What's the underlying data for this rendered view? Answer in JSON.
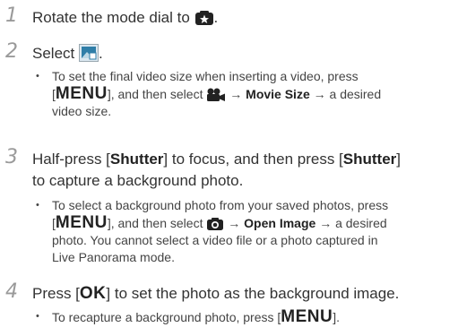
{
  "steps": [
    {
      "number": "1",
      "text_before_icon": "Rotate the mode dial to",
      "text_after_icon": "."
    },
    {
      "number": "2",
      "text_before_icon": "Select",
      "text_after_icon": ".",
      "bullet": {
        "line1": "To set the final video size when inserting a video, press",
        "bracket_open": "[",
        "menu_key": "MENU",
        "bracket_close": "], and then select",
        "arrow1": "→",
        "item": "Movie Size",
        "arrow2": "→",
        "line3": "a desired",
        "line4": "video size."
      }
    },
    {
      "number": "3",
      "t1": "Half-press [",
      "shutter1": "Shutter",
      "t2": "] to focus, and then press [",
      "shutter2": "Shutter",
      "t3": "]",
      "t4": "to capture a background photo.",
      "bullet": {
        "line1": "To select a background photo from your saved photos, press",
        "bracket_open": "[",
        "menu_key": "MENU",
        "bracket_close": "], and then select",
        "arrow1": "→",
        "item": "Open Image",
        "arrow2": "→",
        "tail": "a desired",
        "line3": "photo. You cannot select a video file or a photo captured in",
        "line4": "Live Panorama mode."
      }
    },
    {
      "number": "4",
      "t1": "Press [",
      "ok_key": "OK",
      "t2": "] to set the photo as the background image.",
      "bullet": {
        "text": "To recapture a background photo, press [",
        "menu_key": "MENU",
        "close": "]."
      }
    }
  ],
  "bullet_char": "•",
  "icons": [
    "star-scene-mode-icon",
    "photo-frame-mode-icon",
    "movie-camera-icon",
    "camera-icon"
  ]
}
